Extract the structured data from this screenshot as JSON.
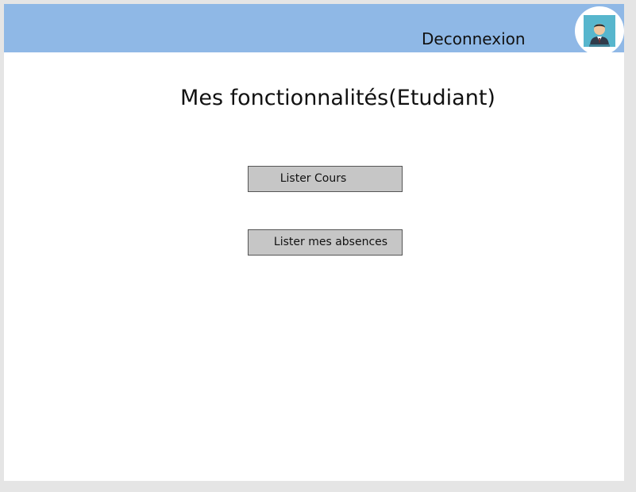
{
  "header": {
    "logout_label": "Deconnexion",
    "avatar_icon": "user-avatar-icon",
    "background_color": "#8fb8e6"
  },
  "main": {
    "title": "Mes fonctionnalités(Etudiant)",
    "buttons": [
      {
        "label": "Lister Cours"
      },
      {
        "label": "Lister mes absences"
      }
    ]
  }
}
